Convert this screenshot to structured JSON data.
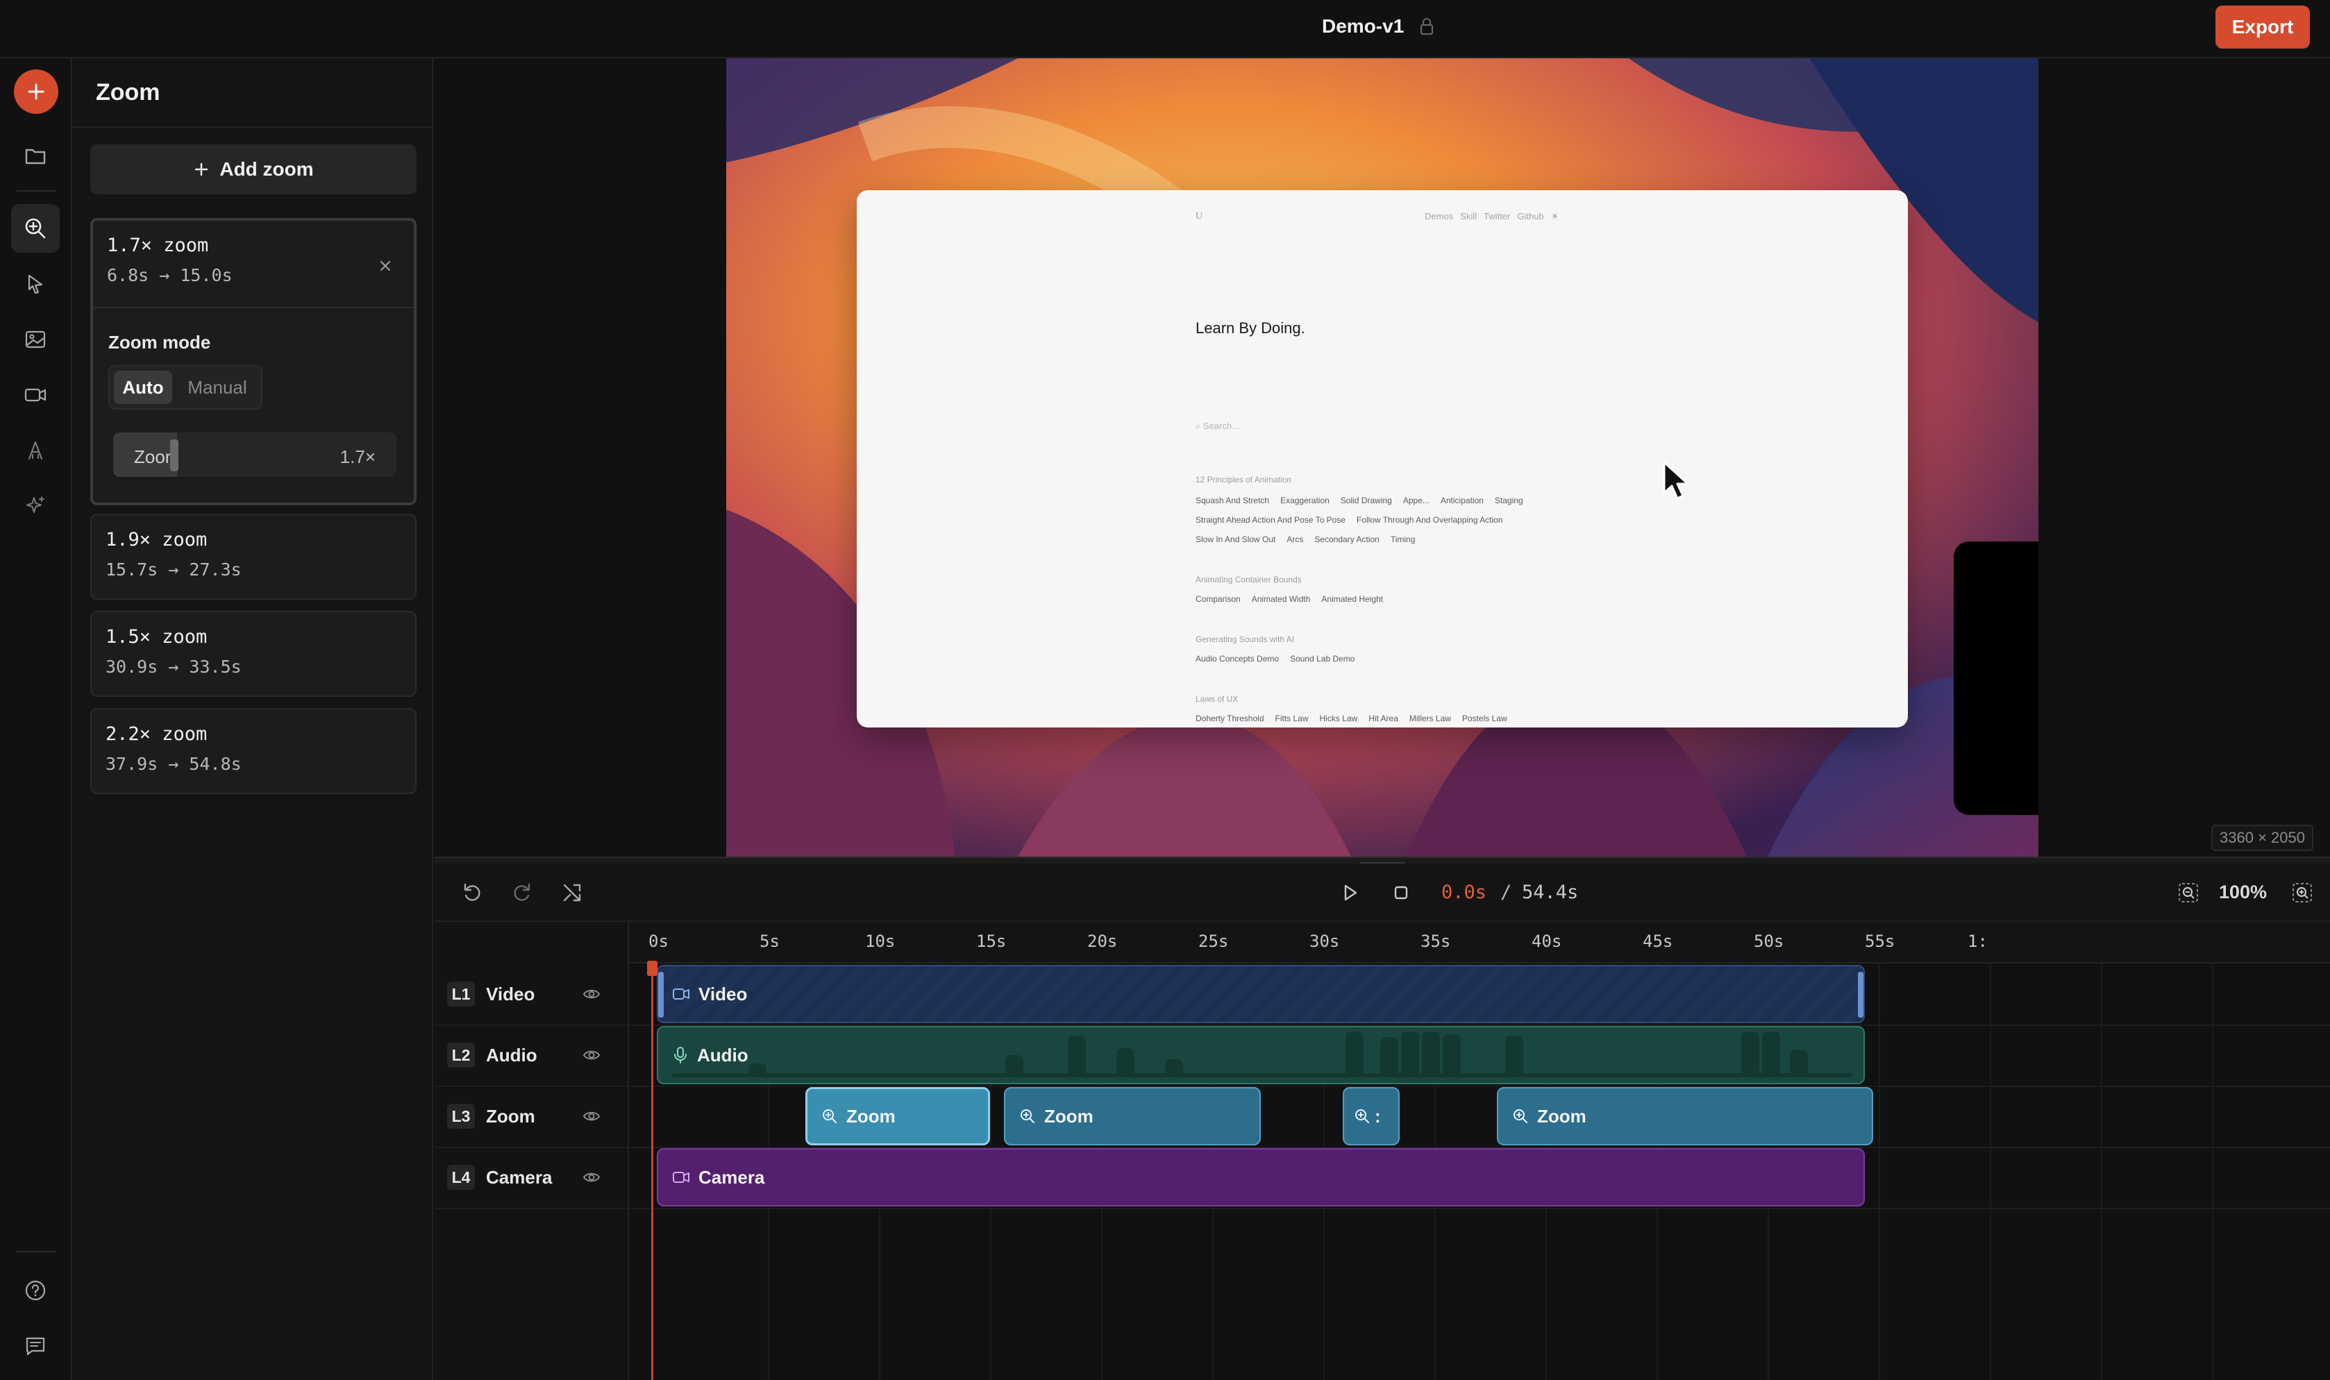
{
  "header": {
    "title": "Demo-v1",
    "export_label": "Export"
  },
  "rail": {
    "items": [
      "add",
      "folder",
      "zoom",
      "cursor",
      "background",
      "camera",
      "text",
      "effects"
    ],
    "bottom": [
      "help",
      "feedback"
    ]
  },
  "panel": {
    "title": "Zoom",
    "add_label": "Add zoom",
    "zooms": [
      {
        "title": "1.7× zoom",
        "range": "6.8s → 15.0s",
        "expanded": true
      },
      {
        "title": "1.9× zoom",
        "range": "15.7s → 27.3s"
      },
      {
        "title": "1.5× zoom",
        "range": "30.9s → 33.5s"
      },
      {
        "title": "2.2× zoom",
        "range": "37.9s → 54.8s"
      }
    ],
    "zoom_mode_label": "Zoom mode",
    "mode_options": [
      "Auto",
      "Manual"
    ],
    "selected_mode": "Auto",
    "slider_label": "Zoor",
    "slider_value": "1.7×",
    "slider_fraction": 0.17
  },
  "preview": {
    "resolution": "3360 × 2050",
    "screen": {
      "logo": "U",
      "nav": [
        "Demos",
        "Skill",
        "Twitter",
        "Github",
        "☀"
      ],
      "heading": "Learn By Doing.",
      "search_placeholder": "Search...",
      "sections": [
        {
          "title": "12 Principles of Animation",
          "rows": [
            [
              "Squash And Stretch",
              "Exaggeration",
              "Solid Drawing",
              "Appe...",
              "Anticipation",
              "Staging"
            ],
            [
              "Straight Ahead Action And Pose To Pose",
              "Follow Through And Overlapping Action"
            ],
            [
              "Slow In And Slow Out",
              "Arcs",
              "Secondary Action",
              "Timing"
            ]
          ]
        },
        {
          "title": "Animating Container Bounds",
          "rows": [
            [
              "Comparison",
              "Animated Width",
              "Animated Height"
            ]
          ]
        },
        {
          "title": "Generating Sounds with AI",
          "rows": [
            [
              "Audio Concepts Demo",
              "Sound Lab Demo"
            ]
          ]
        },
        {
          "title": "Laws of UX",
          "rows": [
            [
              "Doherty Threshold",
              "Fitts Law",
              "Hicks Law",
              "Hit Area",
              "Millers Law",
              "Postels Law"
            ]
          ]
        }
      ]
    }
  },
  "transport": {
    "current": "0.0s",
    "separator": "/",
    "total": "54.4s",
    "zoom_percent": "100%"
  },
  "timeline": {
    "ruler": [
      "0s",
      "5s",
      "10s",
      "15s",
      "20s",
      "25s",
      "30s",
      "35s",
      "40s",
      "45s",
      "50s",
      "55s",
      "1:"
    ],
    "tracks": [
      {
        "id": "L1",
        "name": "Video"
      },
      {
        "id": "L2",
        "name": "Audio"
      },
      {
        "id": "L3",
        "name": "Zoom"
      },
      {
        "id": "L4",
        "name": "Camera"
      }
    ],
    "clips": {
      "video": "Video",
      "audio": "Audio",
      "camera": "Camera",
      "zoom": [
        "Zoom",
        "Zoom",
        ":",
        "Zoom"
      ]
    }
  },
  "colors": {
    "accent": "#d64a2e",
    "video": "#1c2f50",
    "audio": "#19473f",
    "zoom": "#2d6e8c",
    "camera": "#54206e"
  }
}
